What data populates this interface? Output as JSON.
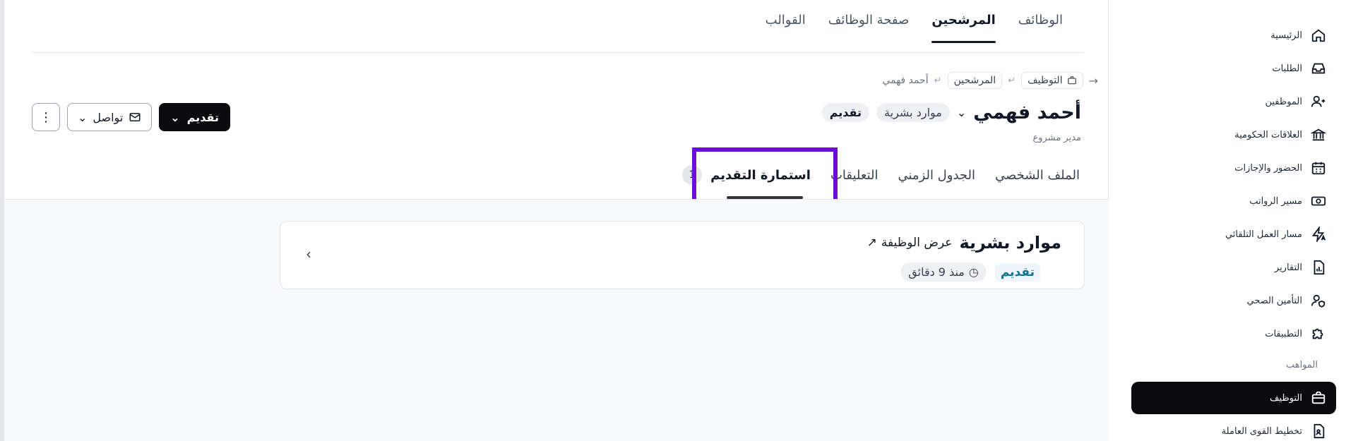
{
  "top_tabs": [
    {
      "label": "الوظائف"
    },
    {
      "label": "المرشحين"
    },
    {
      "label": "صفحة الوظائف"
    },
    {
      "label": "القوالب"
    }
  ],
  "breadcrumb": {
    "back_icon": "arrow-right-icon",
    "recruitment": "التوظيف",
    "candidates": "المرشحين",
    "current": "أحمد فهمي"
  },
  "candidate": {
    "name": "أحمد فهمي",
    "department_tag": "موارد بشرية",
    "stage_tag": "تقديم",
    "job_title": "مدير مشروع"
  },
  "actions": {
    "primary_label": "تقديم",
    "contact_label": "تواصل"
  },
  "sub_tabs": {
    "profile": "الملف الشخصي",
    "timeline": "الجدول الزمني",
    "comments": "التعليقات",
    "application_form": "استمارة التقديم",
    "application_count": "1"
  },
  "application_card": {
    "title": "موارد بشرية",
    "view_job_label": "عرض الوظيفة",
    "stage": "تقديم",
    "time_ago": "منذ 9 دقائق"
  },
  "sidebar": {
    "items": [
      {
        "label": "الرئيسية",
        "icon": "home-icon"
      },
      {
        "label": "الطلبات",
        "icon": "inbox-icon"
      },
      {
        "label": "الموظفين",
        "icon": "users-icon"
      },
      {
        "label": "العلاقات الحكومية",
        "icon": "government-icon"
      },
      {
        "label": "الحضور والإجازات",
        "icon": "calendar-icon"
      },
      {
        "label": "مسير الرواتب",
        "icon": "money-icon"
      },
      {
        "label": "مسار العمل التلقائي",
        "icon": "automation-icon"
      },
      {
        "label": "التقارير",
        "icon": "reports-icon"
      },
      {
        "label": "التأمين الصحي",
        "icon": "insurance-icon"
      },
      {
        "label": "التطبيقات",
        "icon": "puzzle-icon"
      }
    ],
    "section_label": "المواهب",
    "talent_items": [
      {
        "label": "التوظيف",
        "icon": "briefcase-icon",
        "active": true
      },
      {
        "label": "تخطيط القوى العاملة",
        "icon": "workforce-icon"
      }
    ]
  },
  "colors": {
    "highlight_border": "#6a0dd6",
    "primary_button": "#0b0b0f",
    "stage_text": "#0e7490"
  }
}
